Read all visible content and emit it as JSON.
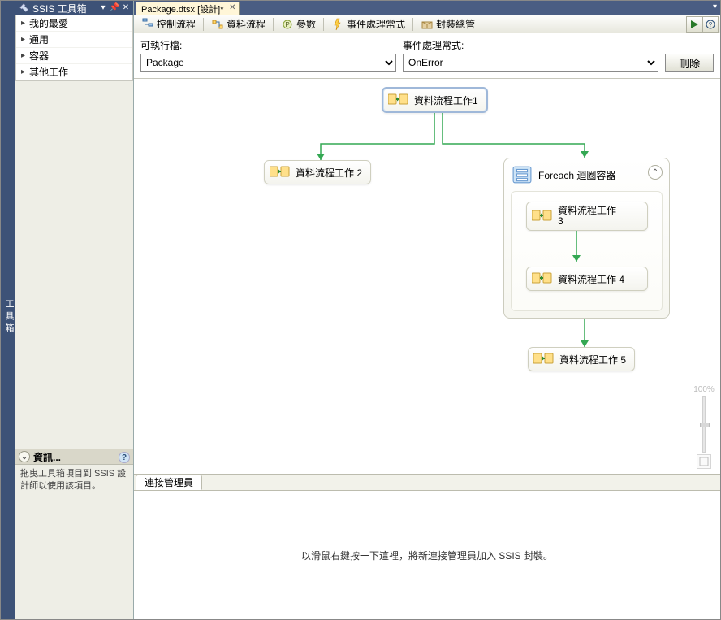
{
  "sidebar_vertical_tab": "工具箱",
  "toolbox": {
    "title": "SSIS 工具箱",
    "items": [
      "我的最愛",
      "通用",
      "容器",
      "其他工作"
    ]
  },
  "info": {
    "title": "資訊...",
    "body": "拖曳工具箱項目到 SSIS 設計師以使用該項目。"
  },
  "doc_tab": {
    "label": "Package.dtsx [設計]*"
  },
  "toolbar": {
    "control_flow": "控制流程",
    "data_flow": "資料流程",
    "parameters": "參數",
    "event_handlers": "事件處理常式",
    "package_explorer": "封裝總管"
  },
  "selectors": {
    "executable_label": "可執行檔:",
    "executable_value": "Package",
    "handler_label": "事件處理常式:",
    "handler_value": "OnError",
    "delete_label": "刪除"
  },
  "nodes": {
    "task1": "資料流程工作1",
    "task2": "資料流程工作 2",
    "foreach": "Foreach 迴圈容器",
    "task3_a": "資料流程工作",
    "task3_b": "3",
    "task4": "資料流程工作 4",
    "task5": "資料流程工作 5"
  },
  "zoom_label": "100%",
  "conn": {
    "tab": "連接管理員",
    "hint": "以滑鼠右鍵按一下這裡，將新連接管理員加入 SSIS 封裝。"
  }
}
